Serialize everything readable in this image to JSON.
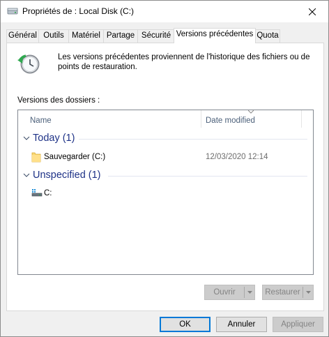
{
  "window": {
    "title": "Propriétés de : Local Disk (C:)"
  },
  "tabs": [
    {
      "label": "Général"
    },
    {
      "label": "Outils"
    },
    {
      "label": "Matériel"
    },
    {
      "label": "Partage"
    },
    {
      "label": "Sécurité"
    },
    {
      "label": "Versions précédentes",
      "active": true
    },
    {
      "label": "Quota"
    }
  ],
  "panel": {
    "description": "Les versions précédentes proviennent de l'historique des fichiers ou de points de restauration.",
    "list_label": "Versions des dossiers :",
    "columns": {
      "name": "Name",
      "date": "Date modified"
    },
    "groups": [
      {
        "title": "Today (1)",
        "items": [
          {
            "name": "Sauvegarder (C:)",
            "date": "12/03/2020 12:14",
            "icon": "folder-icon"
          }
        ]
      },
      {
        "title": "Unspecified (1)",
        "items": [
          {
            "name": "C:",
            "date": "",
            "icon": "drive-icon"
          }
        ]
      }
    ],
    "open_button": "Ouvrir",
    "restore_button": "Restaurer"
  },
  "footer": {
    "ok": "OK",
    "cancel": "Annuler",
    "apply": "Appliquer"
  },
  "colors": {
    "group_title": "#1e3287",
    "focus_border": "#0078d7"
  }
}
